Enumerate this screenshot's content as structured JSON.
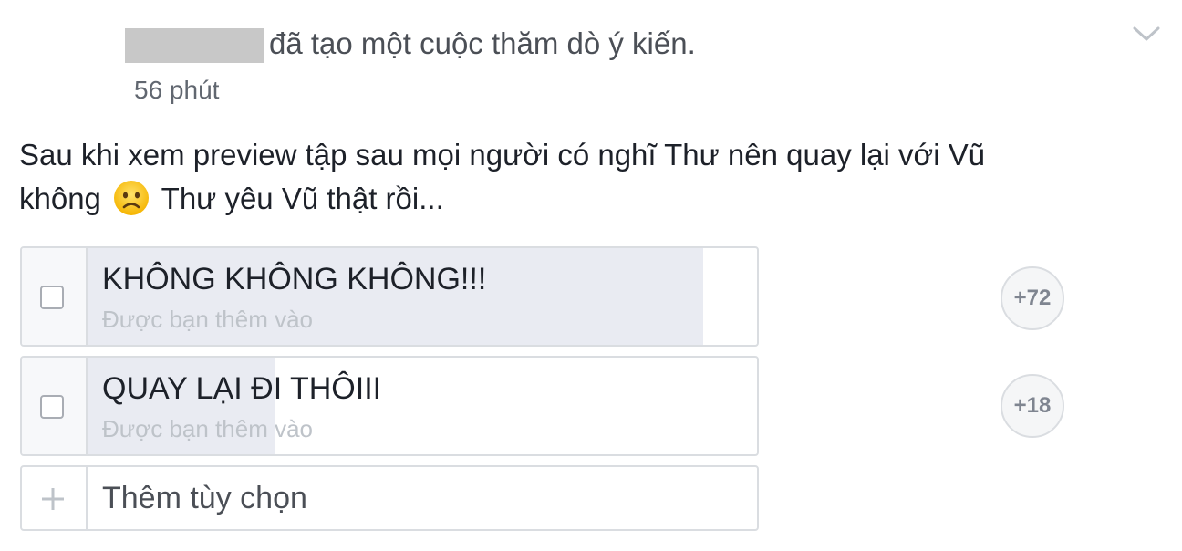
{
  "post": {
    "header_action": "đã tạo một cuộc thăm dò ý kiến.",
    "timestamp": "56 phút",
    "text_line1": "Sau khi xem preview tập sau mọi người có nghĩ Thư nên quay lại với Vũ",
    "text_line2_before": "không",
    "text_line2_after": "Thư yêu Vũ thật rồi...",
    "emoji": "frowning-face-emoji"
  },
  "poll": {
    "options": [
      {
        "label": "KHÔNG KHÔNG KHÔNG!!!",
        "added_by": "Được bạn thêm vào",
        "votes_badge": "+72",
        "vote_share": 0.92
      },
      {
        "label": "QUAY LẠI ĐI THÔIII",
        "added_by": "Được bạn thêm vào",
        "votes_badge": "+18",
        "vote_share": 0.28
      }
    ],
    "add_option_placeholder": "Thêm tùy chọn"
  },
  "icons": {
    "menu": "chevron-down-icon",
    "add": "plus-icon",
    "checkbox": "checkbox-icon"
  },
  "colors": {
    "bar_fill": "#e9ebf2",
    "border": "#dadde1",
    "muted_text": "#bec3c9"
  }
}
